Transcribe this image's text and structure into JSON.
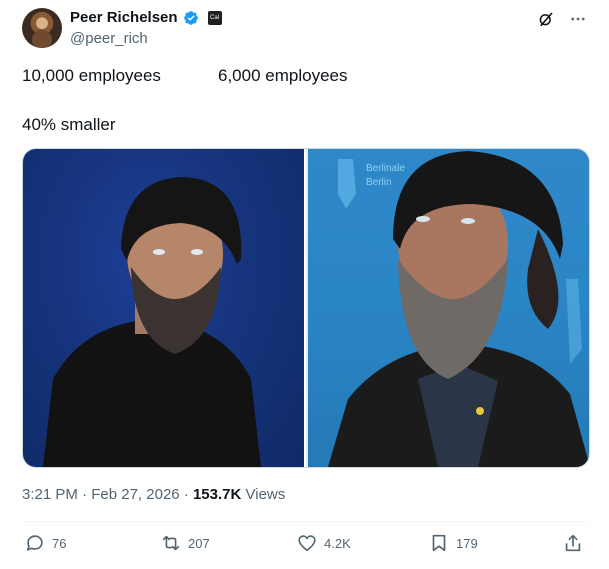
{
  "author": {
    "display_name": "Peer Richelsen",
    "handle": "@peer_rich",
    "affiliation_badge": "Cal"
  },
  "text": {
    "line1_left": "10,000 employees",
    "line1_right": "6,000 employees",
    "line2": "40% smaller"
  },
  "meta": {
    "time": "3:21 PM",
    "dot1": "·",
    "date": "Feb 27, 2026",
    "dot2": "·",
    "views_count": "153.7K",
    "views_label": "Views"
  },
  "actions": {
    "replies": "76",
    "reposts": "207",
    "likes": "4.2K",
    "bookmarks": "179"
  },
  "colors": {
    "verified": "#1d9bf0",
    "muted": "#536471",
    "text": "#0f1419"
  },
  "icons": {
    "grok": "grok-icon",
    "more": "more-icon",
    "reply": "reply-icon",
    "repost": "repost-icon",
    "like": "heart-icon",
    "bookmark": "bookmark-icon",
    "share": "share-icon"
  }
}
